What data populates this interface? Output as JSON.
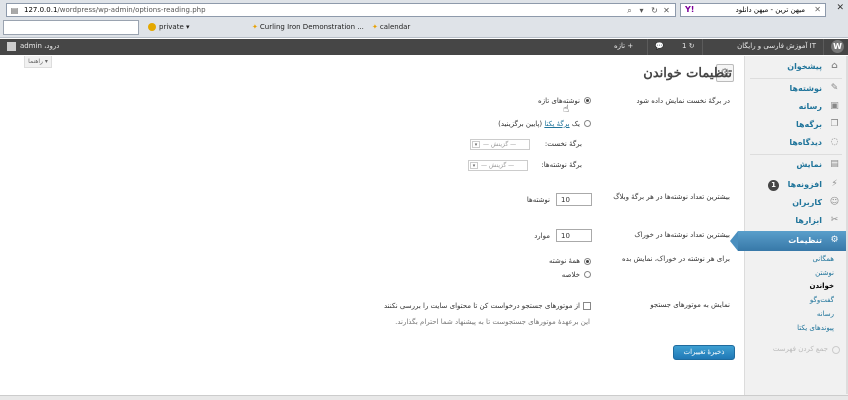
{
  "browser": {
    "url_prefix": "127.0.0.1",
    "url_path": "/wordpress/wp-admin/options-reading.php",
    "tab_title": "میهن ترین - میهن دانلود",
    "bookmarks": [
      "private",
      "Curling Iron Demonstration ...",
      "calendar"
    ]
  },
  "adminbar": {
    "site_name": "آموزش فارسی و رایگان IT",
    "updates_count": "1",
    "new_label": "تازه",
    "howdy": "درود، admin"
  },
  "sidebar": {
    "items": [
      {
        "label": "پیشخوان",
        "icon": "dashboard-icon"
      },
      {
        "label": "نوشته‌ها",
        "icon": "pin-icon"
      },
      {
        "label": "رسانه",
        "icon": "media-icon"
      },
      {
        "label": "برگه‌ها",
        "icon": "pages-icon"
      },
      {
        "label": "دیدگاه‌ها",
        "icon": "comments-icon"
      },
      {
        "label": "نمایش",
        "icon": "appearance-icon"
      },
      {
        "label": "افزونه‌ها",
        "icon": "plugins-icon",
        "badge": "1"
      },
      {
        "label": "کاربران",
        "icon": "users-icon"
      },
      {
        "label": "ابزارها",
        "icon": "tools-icon"
      },
      {
        "label": "تنظیمات",
        "icon": "settings-icon"
      }
    ],
    "submenu": [
      "همگانی",
      "نوشتن",
      "خواندن",
      "گفت‌وگو",
      "رسانه",
      "پیوندهای یکتا"
    ],
    "collapse_label": "جمع کردن فهرست"
  },
  "help_tab": "راهنما",
  "page": {
    "title": "تنظیمات خواندن",
    "front_page_label": "در برگهٔ نخست نمایش داده شود",
    "radio_latest": "نوشته‌های تازه",
    "radio_static_prefix": "یک",
    "radio_static_link": "برگهٔ یکتا",
    "radio_static_suffix": "(پایین برگزینید)",
    "front_page_select_label": "برگهٔ نخست:",
    "posts_page_select_label": "برگهٔ نوشته‌ها:",
    "select_placeholder": "— گزینش —",
    "posts_per_page_label": "بیشترین تعداد نوشته‌ها در هر برگهٔ وبلاگ",
    "posts_per_page_value": "10",
    "posts_per_page_unit": "نوشته‌ها",
    "feed_items_label": "بیشترین تعداد نوشته‌ها در خوراک",
    "feed_items_value": "10",
    "feed_items_unit": "موارد",
    "feed_show_label": "برای هر نوشته در خوراک، نمایش بده",
    "feed_full": "همهٔ نوشته",
    "feed_summary": "خلاصه",
    "search_vis_label": "نمایش به موتورهای جستجو",
    "search_vis_checkbox": "از موتورهای جستجو درخواست کن تا محتوای سایت را بررسی نکنند",
    "search_vis_hint": "این برعهدهٔ موتورهای جستجوست تا به پیشنهاد شما احترام بگذارند.",
    "save_button": "ذخیرهٔ تغییرات"
  }
}
